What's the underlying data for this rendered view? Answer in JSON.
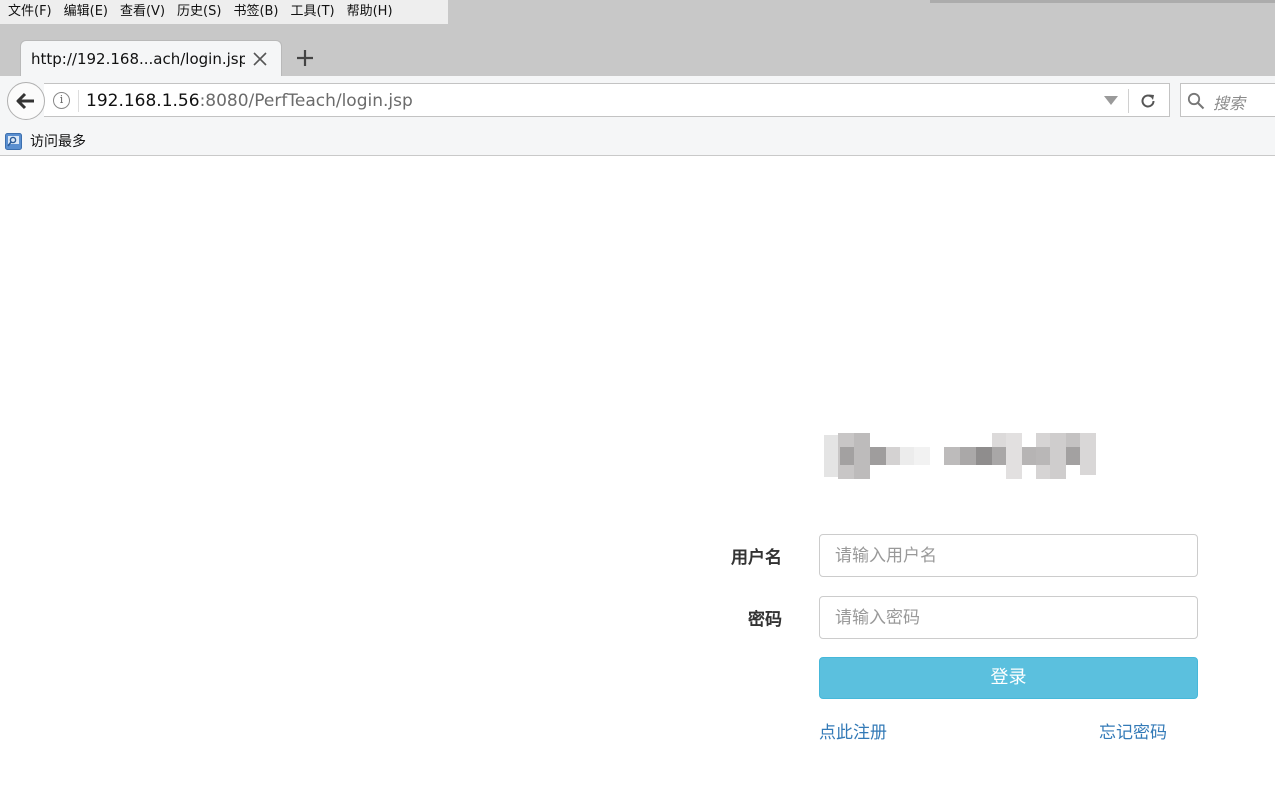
{
  "menubar": {
    "items": [
      "文件(F)",
      "编辑(E)",
      "查看(V)",
      "历史(S)",
      "书签(B)",
      "工具(T)",
      "帮助(H)"
    ]
  },
  "tab": {
    "title": "http://192.168...ach/login.jsp",
    "close_icon": "close-icon",
    "new_tab_icon": "plus-icon"
  },
  "navbar": {
    "url_host": "192.168.1.56",
    "url_rest": ":8080/PerfTeach/login.jsp",
    "search_placeholder": "搜索"
  },
  "bookmarks": {
    "items": [
      {
        "label": "访问最多",
        "icon": "bookmark-folder-icon"
      }
    ]
  },
  "login": {
    "username_label": "用户名",
    "username_placeholder": "请输入用户名",
    "username_value": "",
    "password_label": "密码",
    "password_placeholder": "请输入密码",
    "password_value": "",
    "submit_label": "登录",
    "register_link": "点此注册",
    "forgot_link": "忘记密码"
  },
  "colors": {
    "chrome_bg": "#c8c8c8",
    "toolbar_bg": "#f5f6f7",
    "login_button": "#5bc0de",
    "link": "#337ab7"
  }
}
